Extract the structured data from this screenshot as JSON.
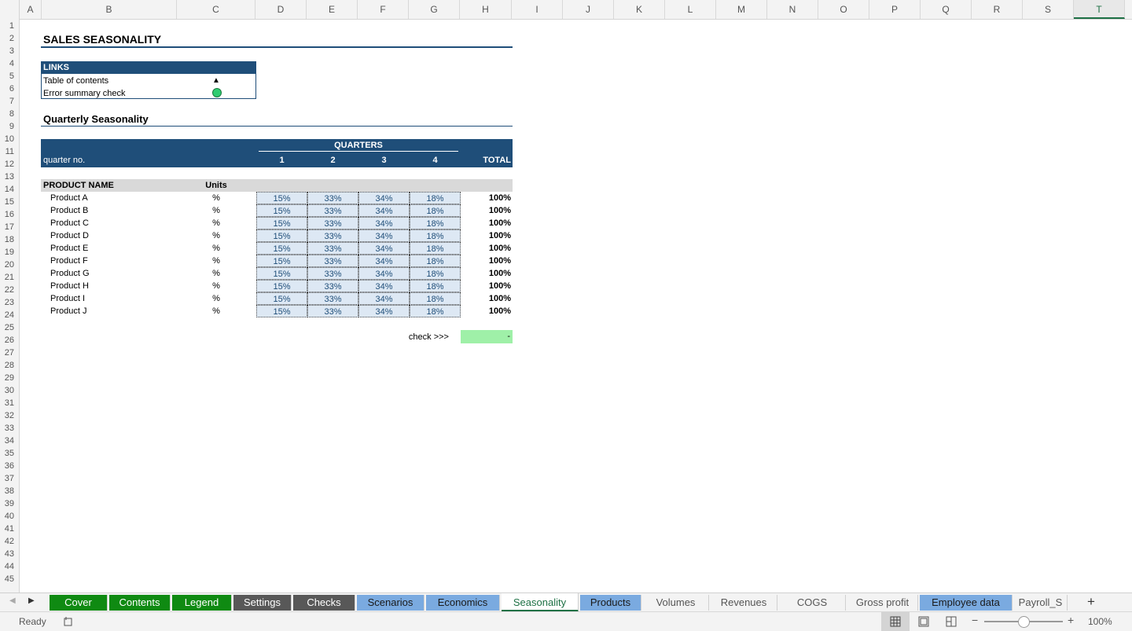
{
  "columns": [
    "A",
    "B",
    "C",
    "D",
    "E",
    "F",
    "G",
    "H",
    "I",
    "J",
    "K",
    "L",
    "M",
    "N",
    "O",
    "P",
    "Q",
    "R",
    "S",
    "T"
  ],
  "rows": [
    "1",
    "2",
    "3",
    "4",
    "5",
    "6",
    "7",
    "8",
    "9",
    "10",
    "11",
    "12",
    "13",
    "14",
    "15",
    "16",
    "17",
    "18",
    "19",
    "20",
    "21",
    "22",
    "23",
    "24",
    "25",
    "26",
    "27",
    "28",
    "29",
    "30",
    "31",
    "32",
    "33",
    "34",
    "35",
    "36",
    "37",
    "38",
    "39",
    "40",
    "41",
    "42",
    "43",
    "44",
    "45"
  ],
  "sheet": {
    "title": "SALES SEASONALITY",
    "links": {
      "header": "LINKS",
      "items": [
        {
          "label": "Table of contents",
          "icon": "▲"
        },
        {
          "label": "Error summary check",
          "icon": "●"
        }
      ]
    },
    "section_title": "Quarterly Seasonality",
    "header_bar": {
      "group_label": "QUARTERS",
      "row_label": "quarter no.",
      "quarters": [
        "1",
        "2",
        "3",
        "4"
      ],
      "total_label": "TOTAL"
    },
    "table": {
      "col_product": "PRODUCT NAME",
      "col_units": "Units",
      "rows": [
        {
          "name": "Product A",
          "unit": "%",
          "q": [
            "15%",
            "33%",
            "34%",
            "18%"
          ],
          "total": "100%"
        },
        {
          "name": "Product B",
          "unit": "%",
          "q": [
            "15%",
            "33%",
            "34%",
            "18%"
          ],
          "total": "100%"
        },
        {
          "name": "Product C",
          "unit": "%",
          "q": [
            "15%",
            "33%",
            "34%",
            "18%"
          ],
          "total": "100%"
        },
        {
          "name": "Product D",
          "unit": "%",
          "q": [
            "15%",
            "33%",
            "34%",
            "18%"
          ],
          "total": "100%"
        },
        {
          "name": "Product E",
          "unit": "%",
          "q": [
            "15%",
            "33%",
            "34%",
            "18%"
          ],
          "total": "100%"
        },
        {
          "name": "Product F",
          "unit": "%",
          "q": [
            "15%",
            "33%",
            "34%",
            "18%"
          ],
          "total": "100%"
        },
        {
          "name": "Product G",
          "unit": "%",
          "q": [
            "15%",
            "33%",
            "34%",
            "18%"
          ],
          "total": "100%"
        },
        {
          "name": "Product H",
          "unit": "%",
          "q": [
            "15%",
            "33%",
            "34%",
            "18%"
          ],
          "total": "100%"
        },
        {
          "name": "Product I",
          "unit": "%",
          "q": [
            "15%",
            "33%",
            "34%",
            "18%"
          ],
          "total": "100%"
        },
        {
          "name": "Product J",
          "unit": "%",
          "q": [
            "15%",
            "33%",
            "34%",
            "18%"
          ],
          "total": "100%"
        }
      ]
    },
    "check": {
      "label": "check >>>",
      "value": "-"
    }
  },
  "tabs": [
    {
      "label": "Cover",
      "style": "green"
    },
    {
      "label": "Contents",
      "style": "green"
    },
    {
      "label": "Legend",
      "style": "green"
    },
    {
      "label": "Settings",
      "style": "grey"
    },
    {
      "label": "Checks",
      "style": "grey"
    },
    {
      "label": "Scenarios",
      "style": "blue"
    },
    {
      "label": "Economics",
      "style": "blue"
    },
    {
      "label": "Seasonality",
      "style": "active"
    },
    {
      "label": "Products",
      "style": "blue"
    },
    {
      "label": "Volumes",
      "style": "plain"
    },
    {
      "label": "Revenues",
      "style": "plain"
    },
    {
      "label": "COGS",
      "style": "plain"
    },
    {
      "label": "Gross profit",
      "style": "plain"
    },
    {
      "label": "Employee data",
      "style": "blue"
    },
    {
      "label": "Payroll_S",
      "style": "plain"
    }
  ],
  "tab_nav": {
    "prev": "◀",
    "next": "▶",
    "add": "+"
  },
  "status": {
    "ready": "Ready",
    "zoom": "100%",
    "zoom_minus": "−",
    "zoom_plus": "+"
  }
}
